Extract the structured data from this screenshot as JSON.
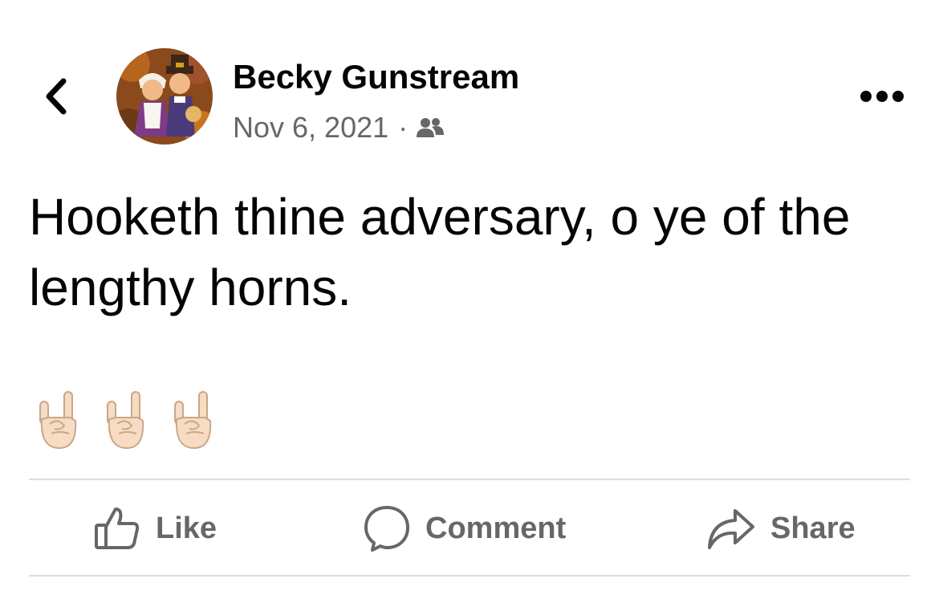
{
  "navigation": {
    "back_icon": "chevron-left-icon",
    "more_icon": "more-horizontal-icon"
  },
  "post": {
    "author": "Becky Gunstream",
    "date": "Nov 6, 2021",
    "separator": "·",
    "audience_icon": "friends-icon",
    "text": "Hooketh thine adversary, o ye of the lengthy horns.",
    "emojis": [
      "🤘🏻",
      "🤘🏻",
      "🤘🏻"
    ]
  },
  "actions": {
    "like": {
      "label": "Like",
      "icon": "thumbs-up-icon"
    },
    "comment": {
      "label": "Comment",
      "icon": "speech-bubble-icon"
    },
    "share": {
      "label": "Share",
      "icon": "share-arrow-icon"
    }
  },
  "colors": {
    "text_primary": "#050505",
    "text_secondary": "#65676b",
    "divider": "#dadde1",
    "background": "#ffffff"
  }
}
